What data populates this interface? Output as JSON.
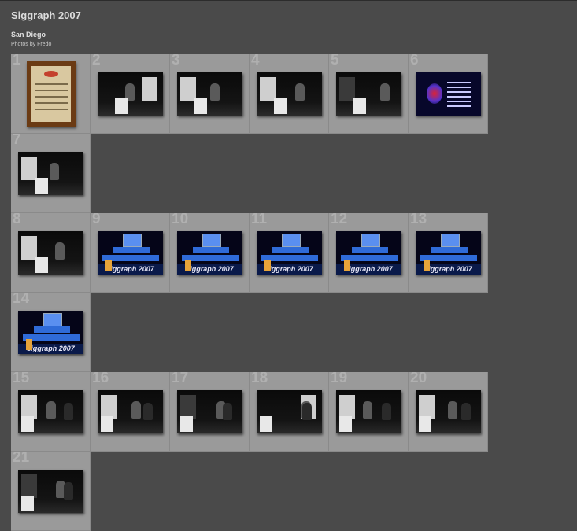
{
  "header": {
    "title": "Siggraph 2007",
    "subtitle": "San Diego",
    "credit": "Photos by Fredo"
  },
  "photos": [
    {
      "n": "1",
      "kind": "plaque"
    },
    {
      "n": "2",
      "kind": "gray"
    },
    {
      "n": "3",
      "kind": "gray"
    },
    {
      "n": "4",
      "kind": "gray"
    },
    {
      "n": "5",
      "kind": "gray"
    },
    {
      "n": "6",
      "kind": "slide"
    },
    {
      "n": "7",
      "kind": "gray"
    },
    {
      "n": "8",
      "kind": "gray"
    },
    {
      "n": "9",
      "kind": "stage"
    },
    {
      "n": "10",
      "kind": "stage"
    },
    {
      "n": "11",
      "kind": "stage"
    },
    {
      "n": "12",
      "kind": "stage"
    },
    {
      "n": "13",
      "kind": "stage"
    },
    {
      "n": "14",
      "kind": "stage"
    },
    {
      "n": "15",
      "kind": "gray"
    },
    {
      "n": "16",
      "kind": "gray"
    },
    {
      "n": "17",
      "kind": "gray"
    },
    {
      "n": "18",
      "kind": "gray"
    },
    {
      "n": "19",
      "kind": "gray"
    },
    {
      "n": "20",
      "kind": "gray"
    },
    {
      "n": "21",
      "kind": "gray"
    }
  ],
  "rows": [
    [
      "1",
      "2",
      "3",
      "4",
      "5",
      "6"
    ],
    [
      "7"
    ],
    [
      "8",
      "9",
      "10",
      "11",
      "12",
      "13"
    ],
    [
      "14"
    ],
    [
      "15",
      "16",
      "17",
      "18",
      "19",
      "20"
    ],
    [
      "21"
    ]
  ],
  "stage_text": "siggraph 2007",
  "colors": {
    "page_bg": "#4a4a4a",
    "cell_bg": "#9a9a9a",
    "stage_blue": "#2f6bd8"
  }
}
